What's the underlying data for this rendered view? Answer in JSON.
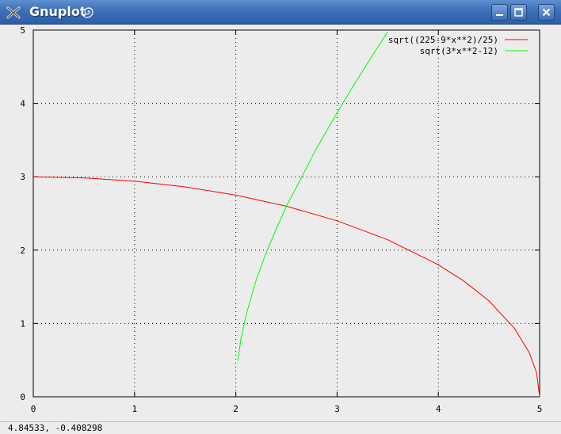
{
  "window": {
    "title": "Gnuplot",
    "icon": "gnuplot-x-icon",
    "colors": {
      "titlebar": "#3d6fb8",
      "background": "#ececec"
    }
  },
  "statusbar": {
    "coordinates": "4.84533, -0.408298"
  },
  "chart_data": {
    "type": "line",
    "title": "",
    "xlabel": "",
    "ylabel": "",
    "xlim": [
      0,
      5
    ],
    "ylim": [
      0,
      5
    ],
    "xticks": [
      "0",
      "1",
      "2",
      "3",
      "4",
      "5"
    ],
    "yticks": [
      "0",
      "1",
      "2",
      "3",
      "4",
      "5"
    ],
    "grid": true,
    "legend_position": "top-right",
    "series": [
      {
        "name": "sqrt((225-9*x**2)/25)",
        "color": "#ff0000",
        "x": [
          0,
          0.5,
          1,
          1.5,
          2,
          2.5,
          3,
          3.5,
          4,
          4.25,
          4.5,
          4.75,
          4.9,
          4.97,
          5
        ],
        "y": [
          3,
          2.985,
          2.939,
          2.862,
          2.749,
          2.598,
          2.4,
          2.142,
          1.8,
          1.58,
          1.308,
          0.937,
          0.597,
          0.327,
          0
        ]
      },
      {
        "name": "sqrt(3*x**2-12)",
        "color": "#00ff00",
        "x": [
          2.02,
          2.05,
          2.1,
          2.2,
          2.3,
          2.4,
          2.5,
          2.6,
          2.8,
          3,
          3.2,
          3.4,
          3.5
        ],
        "y": [
          0.491,
          0.785,
          1.108,
          1.587,
          1.965,
          2.289,
          2.598,
          2.862,
          3.394,
          3.873,
          4.329,
          4.765,
          4.975
        ]
      }
    ]
  }
}
